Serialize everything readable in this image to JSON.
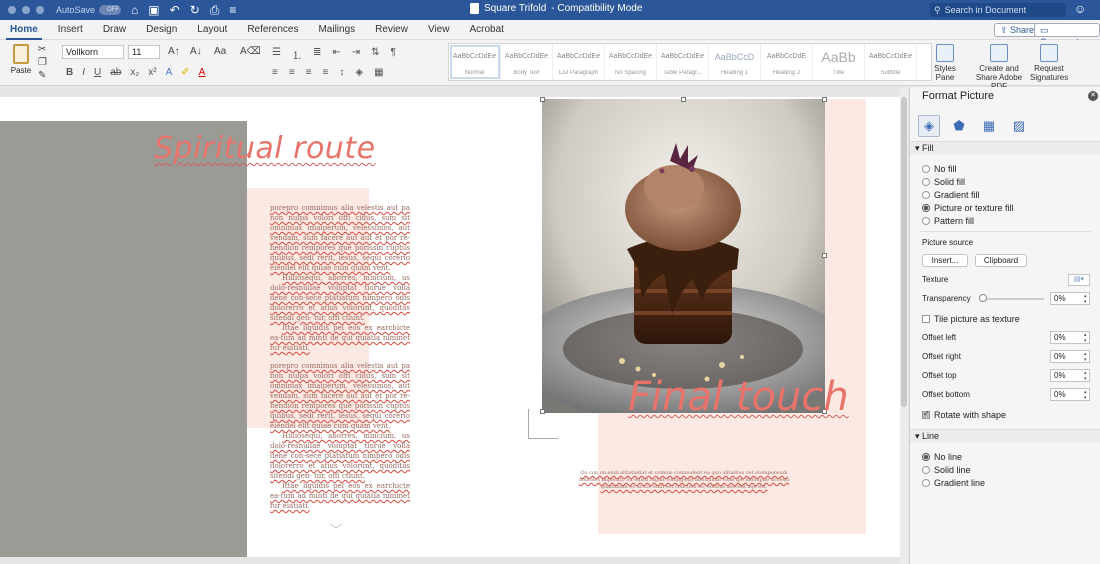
{
  "titlebar": {
    "autosave_label": "AutoSave",
    "autosave_state": "OFF",
    "document_title": "Square Trifold",
    "mode": "-  Compatibility Mode",
    "search_placeholder": "Search in Document"
  },
  "tabs": [
    "Home",
    "Insert",
    "Draw",
    "Design",
    "Layout",
    "References",
    "Mailings",
    "Review",
    "View",
    "Acrobat"
  ],
  "active_tab": "Home",
  "share_label": "Share",
  "comments_label": "Comments",
  "ribbon": {
    "paste_label": "Paste",
    "font_name": "Vollkorn",
    "font_size": "11",
    "styles": [
      {
        "sample": "AaBbCcDdEe",
        "name": "Normal"
      },
      {
        "sample": "AaBbCcDdEe",
        "name": "Body Text"
      },
      {
        "sample": "AaBbCcDdEe",
        "name": "List Paragraph"
      },
      {
        "sample": "AaBbCcDdEe",
        "name": "No Spacing"
      },
      {
        "sample": "AaBbCcDdEe",
        "name": "Table Paragr..."
      },
      {
        "sample": "AaBbCcD",
        "name": "Heading 1"
      },
      {
        "sample": "AaBbCcDdE",
        "name": "Heading 2"
      },
      {
        "sample": "AaBb",
        "name": "Title"
      },
      {
        "sample": "AaBbCcDdEe",
        "name": "Subtitle"
      }
    ],
    "styles_pane_label": "Styles Pane",
    "create_pdf_label": "Create and Share Adobe PDF",
    "request_sig_label": "Request Signatures"
  },
  "document": {
    "heading1": "Spiritual route",
    "heading2": "Final touch",
    "para1": "porepro comnimus alia velestis aut pa non nulpa volori offi cidus, sum sit omnimax imaiperum, velessimos, aut vendam, sum facere aut aut et por re-hendion rempores que porissin cuptus quibus, sedi rerit, iesus, sequi corerio elendel elit quiae cum quam vent.",
    "para2": "Hiiliosequi, aborres, mincium, us dolo-resnullae voluptat tiorue volla dene con-sece ptatiatum nimpero odis dolorerro et atius volorunt, quoditas sitendi gen- tur, offi ctiunt.",
    "para3": "Ittae liquidis pel eos ex earchicte ea-tum ad minti de qui quiatia niminet fur eiatiati.",
    "caption": "Oo con on endi alitatiatiat et comnis comnodent ea quo alitaibus vel otomponsudi dolloiles imperati, Sa edisti fugiat vollingenis aborianim vitas ipe molluptie accessi quanfibum eo acoce endi eot conctem es, eolibus aseceat aqe est."
  },
  "pane": {
    "title": "Format Picture",
    "fill_header": "Fill",
    "fill_options": [
      "No fill",
      "Solid fill",
      "Gradient fill",
      "Picture or texture fill",
      "Pattern fill"
    ],
    "fill_selected": "Picture or texture fill",
    "picture_source_label": "Picture source",
    "insert_button": "Insert...",
    "clipboard_button": "Clipboard",
    "texture_label": "Texture",
    "transparency_label": "Transparency",
    "transparency_value": "0%",
    "tile_label": "Tile picture as texture",
    "offset_left_label": "Offset left",
    "offset_left_value": "0%",
    "offset_right_label": "Offset right",
    "offset_right_value": "0%",
    "offset_top_label": "Offset top",
    "offset_top_value": "0%",
    "offset_bottom_label": "Offset bottom",
    "offset_bottom_value": "0%",
    "rotate_label": "Rotate with shape",
    "line_header": "Line",
    "line_options": [
      "No line",
      "Solid line",
      "Gradient line"
    ],
    "line_selected": "No line"
  },
  "colors": {
    "brand_blue": "#2b579a",
    "heading_coral": "#e8736a",
    "pink_block": "#fde9e4",
    "grey_panel": "#9b9b95"
  }
}
